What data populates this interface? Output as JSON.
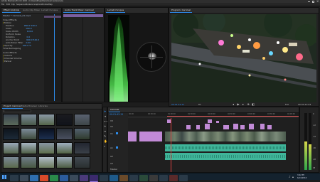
{
  "titlebar": "Adobe Premiere Pro CC 2015 - C:\\Users\\Projects\\Carnival Aerial.prproj",
  "menu": [
    "File",
    "Edit",
    "Clip",
    "Sequence",
    "Markers",
    "Graphics",
    "Window",
    "Help"
  ],
  "source_tabs": [
    "Effect Controls",
    "Audio Clip Mixer",
    "Lumetri Scopes"
  ],
  "mixer_tabs": [
    "Audio Track Mixer: Carnival"
  ],
  "scopes_tab": "Lumetri Scopes",
  "program_tab": "Program: Carnival",
  "effect_controls": {
    "master_label": "Master * Carnival_01.mp4",
    "rows": [
      "Video Effects",
      "Motion",
      "Position",
      "Scale",
      "Scale Width",
      "Uniform Scale",
      "Rotation",
      "Anchor Point",
      "Anti-flicker Filter",
      "Opacity",
      "Time Remapping",
      "Audio Effects",
      "Volume",
      "Channel Volume",
      "Panner"
    ],
    "values": [
      "",
      "",
      "960.0  540.0",
      "100.0",
      "100.0",
      "",
      "0.0",
      "960.0  540.0",
      "0.00",
      "100.0 %",
      "",
      "",
      "",
      "",
      ""
    ]
  },
  "program_monitor": {
    "timecode_left": "00:01:42:11",
    "fit": "Fit",
    "quality": "Full",
    "timecode_right": "00:04:12:03"
  },
  "project_panel": {
    "tabs": [
      "Project: Carnival",
      "Media Browser",
      "Libraries"
    ],
    "search_placeholder": "",
    "clips": [
      "Carnival_01",
      "Carnival_02",
      "Carnival_03",
      "Night_04",
      "Title_05",
      "Road_06",
      "Road_07",
      "Lights_08",
      "Crowd_09",
      "Field_10",
      "Tower_11",
      "Sky_12",
      "Grass_13",
      "Pole_14",
      "Fair_15",
      "Wheel_16",
      "Dusk_17",
      "Park_18",
      "Street_19",
      "Lot_20"
    ],
    "footer": "20 items"
  },
  "timeline": {
    "tab": "Carnival",
    "timecode": "00:01:42:11",
    "ruler": [
      "00:00",
      "00:30:00",
      "01:00:00",
      "01:30:00",
      "02:00:00",
      "02:30:00",
      "03:00:00",
      "03:30:00",
      "04:00:00"
    ],
    "tracks": [
      "V3",
      "V2",
      "V1",
      "A1",
      "A2",
      "A3",
      "Master"
    ]
  },
  "meter_scale": [
    "0",
    "-12",
    "-24",
    "-36",
    "-48",
    "dB"
  ],
  "taskbar": {
    "time": "3:42 PM",
    "date": "6/14/2016"
  },
  "colors": {
    "accent": "#2d8ceb",
    "video_clip": "#c18ad6",
    "audio_clip": "#3fb59a",
    "playhead": "#d84040",
    "in_out": "#e05555"
  }
}
